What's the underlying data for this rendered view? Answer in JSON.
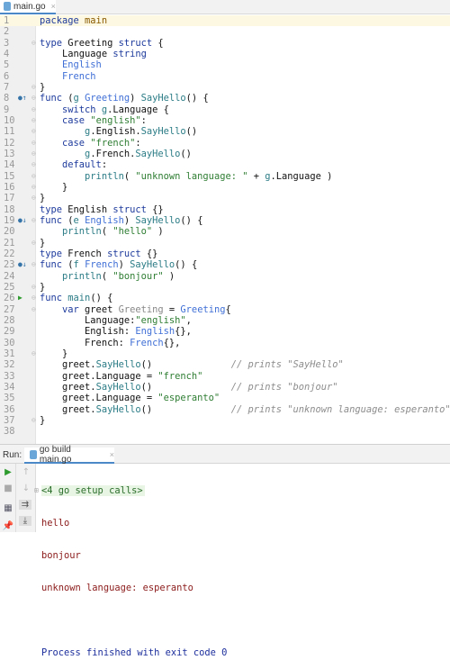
{
  "editor_tab": {
    "label": "main.go",
    "close": "×"
  },
  "code": [
    [
      [
        "k",
        "package "
      ],
      [
        "pk",
        "main"
      ]
    ],
    [],
    [
      [
        "k",
        "type "
      ],
      [
        "n",
        "Greeting "
      ],
      [
        "k",
        "struct "
      ],
      [
        "n",
        "{"
      ]
    ],
    [
      [
        "n",
        "    Language "
      ],
      [
        "k",
        "string"
      ]
    ],
    [
      [
        "t",
        "    English"
      ]
    ],
    [
      [
        "t",
        "    French"
      ]
    ],
    [
      [
        "n",
        "}"
      ]
    ],
    [
      [
        "k",
        "func "
      ],
      [
        "n",
        "("
      ],
      [
        "p",
        "g "
      ],
      [
        "t",
        "Greeting"
      ],
      [
        "n",
        ") "
      ],
      [
        "f",
        "SayHello"
      ],
      [
        "n",
        "() {"
      ]
    ],
    [
      [
        "k",
        "    switch "
      ],
      [
        "p",
        "g"
      ],
      [
        "n",
        ".Language {"
      ]
    ],
    [
      [
        "k",
        "    case "
      ],
      [
        "s",
        "\"english\""
      ],
      [
        "n",
        ":"
      ]
    ],
    [
      [
        "p",
        "        g"
      ],
      [
        "n",
        ".English."
      ],
      [
        "f",
        "SayHello"
      ],
      [
        "n",
        "()"
      ]
    ],
    [
      [
        "k",
        "    case "
      ],
      [
        "s",
        "\"french\""
      ],
      [
        "n",
        ":"
      ]
    ],
    [
      [
        "p",
        "        g"
      ],
      [
        "n",
        ".French."
      ],
      [
        "f",
        "SayHello"
      ],
      [
        "n",
        "()"
      ]
    ],
    [
      [
        "k",
        "    default"
      ],
      [
        "n",
        ":"
      ]
    ],
    [
      [
        "f",
        "        println"
      ],
      [
        "n",
        "( "
      ],
      [
        "s",
        "\"unknown language: \""
      ],
      [
        "n",
        " + "
      ],
      [
        "p",
        "g"
      ],
      [
        "n",
        ".Language )"
      ]
    ],
    [
      [
        "n",
        "    }"
      ]
    ],
    [
      [
        "n",
        "}"
      ]
    ],
    [
      [
        "k",
        "type "
      ],
      [
        "n",
        "English "
      ],
      [
        "k",
        "struct "
      ],
      [
        "n",
        "{}"
      ]
    ],
    [
      [
        "k",
        "func "
      ],
      [
        "n",
        "("
      ],
      [
        "p",
        "e "
      ],
      [
        "t",
        "English"
      ],
      [
        "n",
        ") "
      ],
      [
        "f",
        "SayHello"
      ],
      [
        "n",
        "() {"
      ]
    ],
    [
      [
        "f",
        "    println"
      ],
      [
        "n",
        "( "
      ],
      [
        "s",
        "\"hello\""
      ],
      [
        "n",
        " )"
      ]
    ],
    [
      [
        "n",
        "}"
      ]
    ],
    [
      [
        "k",
        "type "
      ],
      [
        "n",
        "French "
      ],
      [
        "k",
        "struct "
      ],
      [
        "n",
        "{}"
      ]
    ],
    [
      [
        "k",
        "func "
      ],
      [
        "n",
        "("
      ],
      [
        "p",
        "f "
      ],
      [
        "t",
        "French"
      ],
      [
        "n",
        ") "
      ],
      [
        "f",
        "SayHello"
      ],
      [
        "n",
        "() {"
      ]
    ],
    [
      [
        "f",
        "    println"
      ],
      [
        "n",
        "( "
      ],
      [
        "s",
        "\"bonjour\""
      ],
      [
        "n",
        " )"
      ]
    ],
    [
      [
        "n",
        "}"
      ]
    ],
    [
      [
        "k",
        "func "
      ],
      [
        "f",
        "main"
      ],
      [
        "n",
        "() {"
      ]
    ],
    [
      [
        "k",
        "    var "
      ],
      [
        "n",
        "greet "
      ],
      [
        "g",
        "Greeting"
      ],
      [
        "n",
        " = "
      ],
      [
        "t",
        "Greeting"
      ],
      [
        "n",
        "{"
      ]
    ],
    [
      [
        "n",
        "        Language:"
      ],
      [
        "s",
        "\"english\""
      ],
      [
        "n",
        ","
      ]
    ],
    [
      [
        "n",
        "        English: "
      ],
      [
        "t",
        "English"
      ],
      [
        "n",
        "{},"
      ]
    ],
    [
      [
        "n",
        "        French: "
      ],
      [
        "t",
        "French"
      ],
      [
        "n",
        "{},"
      ]
    ],
    [
      [
        "n",
        "    }"
      ]
    ],
    [
      [
        "n",
        "    greet."
      ],
      [
        "f",
        "SayHello"
      ],
      [
        "n",
        "()              "
      ],
      [
        "c",
        "// prints \"SayHello\""
      ]
    ],
    [
      [
        "n",
        "    greet.Language = "
      ],
      [
        "s",
        "\"french\""
      ]
    ],
    [
      [
        "n",
        "    greet."
      ],
      [
        "f",
        "SayHello"
      ],
      [
        "n",
        "()              "
      ],
      [
        "c",
        "// prints \"bonjour\""
      ]
    ],
    [
      [
        "n",
        "    greet.Language = "
      ],
      [
        "s",
        "\"esperanto\""
      ]
    ],
    [
      [
        "n",
        "    greet."
      ],
      [
        "f",
        "SayHello"
      ],
      [
        "n",
        "()              "
      ],
      [
        "c",
        "// prints \"unknown language: esperanto\""
      ]
    ],
    [
      [
        "n",
        "}"
      ]
    ],
    []
  ],
  "gutter_marks": {
    "8": "implements-up",
    "19": "implemented-down",
    "23": "implemented-down",
    "26": "run"
  },
  "fold_lines": [
    3,
    7,
    8,
    9,
    10,
    11,
    12,
    13,
    14,
    15,
    16,
    17,
    19,
    21,
    23,
    25,
    26,
    27,
    31,
    37
  ],
  "run_panel": {
    "label": "Run:",
    "tab": "go build main.go",
    "close": "×",
    "console": {
      "setup": "<4 go setup calls>",
      "output": [
        "hello",
        "bonjour",
        "unknown language: esperanto"
      ],
      "finished": "Process finished with exit code 0"
    }
  }
}
